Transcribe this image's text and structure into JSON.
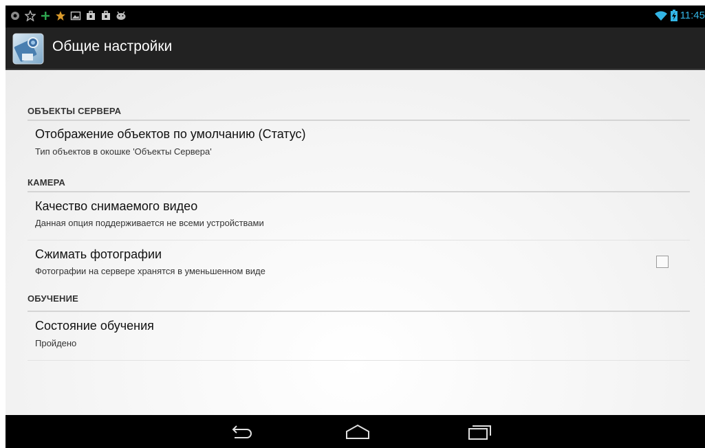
{
  "status_bar": {
    "time": "11:45",
    "notification_icons": [
      "settings-shield-icon",
      "star-icon",
      "plus-icon",
      "star-icon",
      "image-icon",
      "bag-icon",
      "bag-icon",
      "android-icon"
    ]
  },
  "action_bar": {
    "title": "Общие настройки"
  },
  "sections": [
    {
      "header": "ОБЪЕКТЫ СЕРВЕРА",
      "items": [
        {
          "title": "Отображение объектов по умолчанию (Статус)",
          "summary": "Тип объектов в окошке 'Объекты Сервера'"
        }
      ]
    },
    {
      "header": "КАМЕРА",
      "items": [
        {
          "title": "Качество снимаемого видео",
          "summary": "Данная опция поддерживается не всеми устройствами"
        },
        {
          "title": "Сжимать фотографии",
          "summary": "Фотографии на сервере хранятся в уменьшенном виде",
          "checked": false
        }
      ]
    },
    {
      "header": "ОБУЧЕНИЕ",
      "items": [
        {
          "title": "Состояние обучения",
          "summary": "Пройдено"
        }
      ]
    }
  ],
  "colors": {
    "accent": "#33b5e5",
    "action_bar": "#222222",
    "status_bar": "#000000"
  }
}
